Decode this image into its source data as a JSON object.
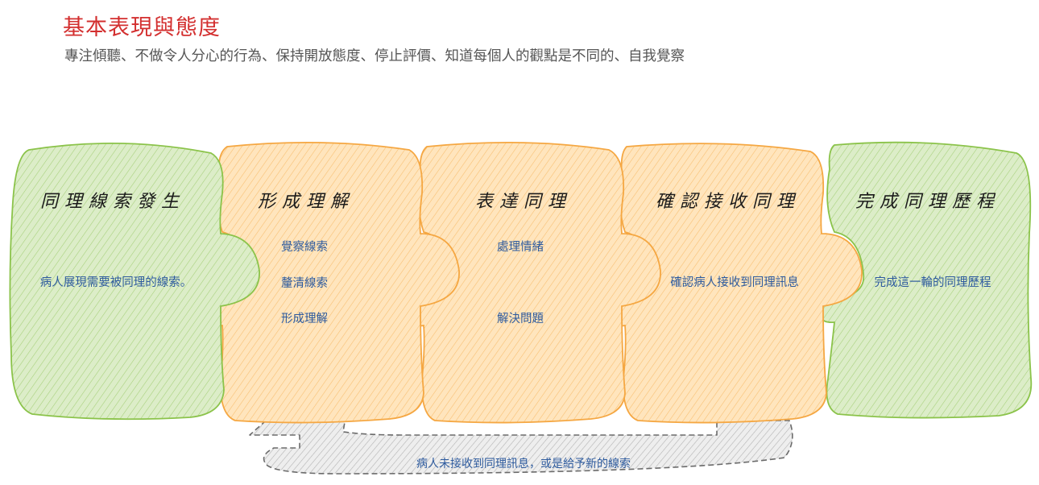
{
  "title": "基本表現與態度",
  "subtitle": "專注傾聽、不做令人分心的行為、保持開放態度、停止評價、知道每個人的觀點是不同的、自我覺察",
  "colors": {
    "title": "#d32f2f",
    "green_fill": "#c5e1a5",
    "green_stroke": "#8bc34a",
    "orange_fill": "#ffd699",
    "orange_stroke": "#f5a742",
    "grey_fill": "#d9d9d9",
    "grey_stroke": "#6b6b6b",
    "item_text": "#2e5b9e"
  },
  "stages": [
    {
      "heading": "同理線索發生",
      "items": [
        "病人展現需要被同理的線索。"
      ],
      "color": "green"
    },
    {
      "heading": "形成理解",
      "items": [
        "覺察線索",
        "釐清線索",
        "形成理解"
      ],
      "color": "orange"
    },
    {
      "heading": "表達同理",
      "items": [
        "處理情緒",
        "解決問題"
      ],
      "color": "orange"
    },
    {
      "heading": "確認接收同理",
      "items": [
        "確認病人接收到同理訊息"
      ],
      "color": "orange"
    },
    {
      "heading": "完成同理歷程",
      "items": [
        "完成這一輪的同理歷程"
      ],
      "color": "green"
    }
  ],
  "loop": {
    "label": "病人未接收到同理訊息，或是給予新的線索"
  }
}
